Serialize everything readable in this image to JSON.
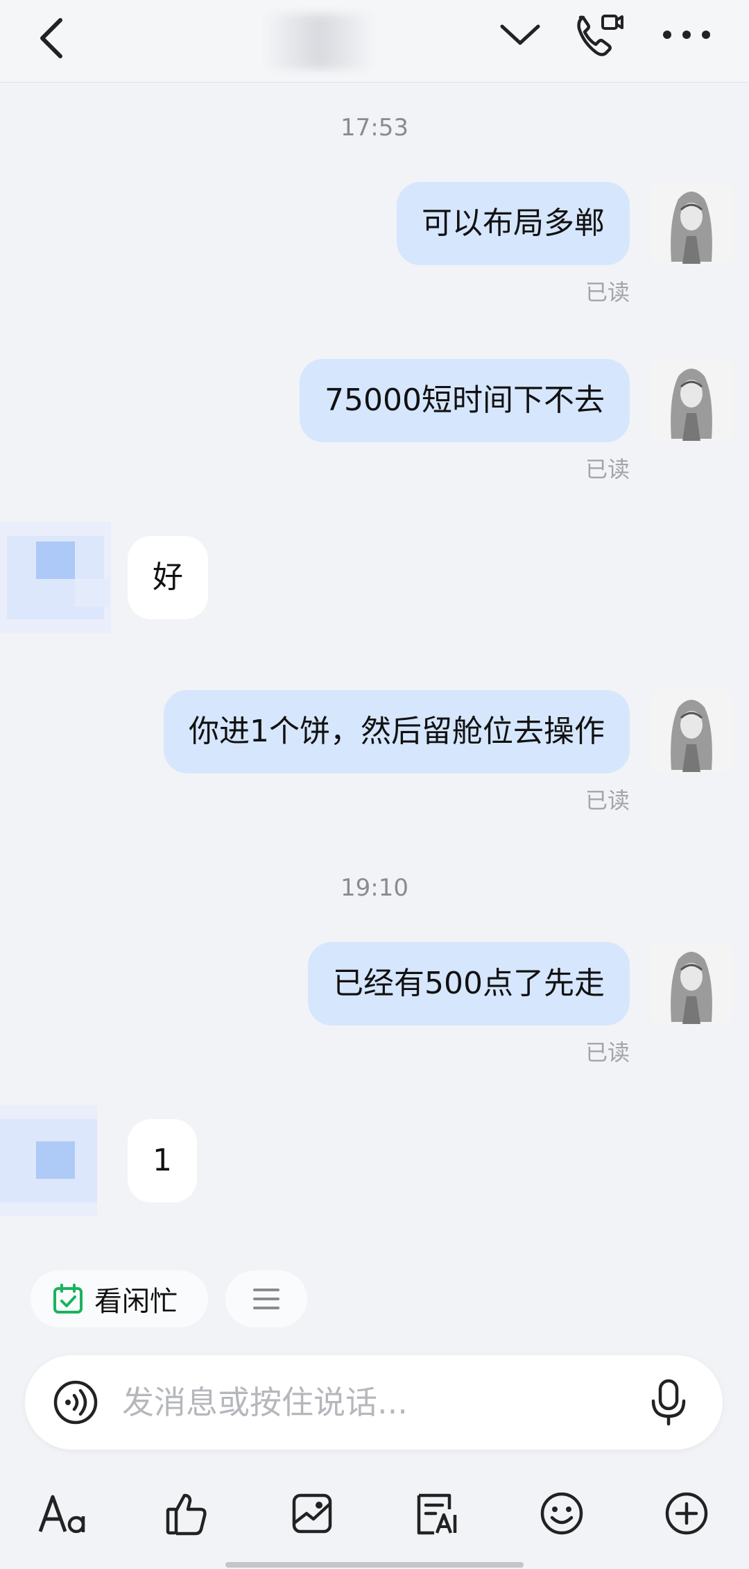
{
  "header": {
    "title": ""
  },
  "messages": [
    {
      "type": "time",
      "text": "17:53"
    },
    {
      "type": "me",
      "text": "可以布局多郸",
      "status": "已读"
    },
    {
      "type": "me",
      "text": "75000短时间下不去",
      "status": "已读"
    },
    {
      "type": "them",
      "text": "好"
    },
    {
      "type": "me",
      "text": "你进1个饼，然后留舱位去操作",
      "status": "已读"
    },
    {
      "type": "time",
      "text": "19:10"
    },
    {
      "type": "me",
      "text": "已经有500点了先走",
      "status": "已读"
    },
    {
      "type": "them",
      "text": "1"
    }
  ],
  "quick_actions": {
    "status_chip": "看闲忙"
  },
  "composer": {
    "placeholder": "发消息或按住说话..."
  },
  "icons": {
    "back": "chevron-left-icon",
    "dropdown": "chevron-down-icon",
    "call": "video-call-icon",
    "more": "more-icon",
    "voice": "voice-icon",
    "mic": "mic-icon",
    "font": "font-icon",
    "like": "thumbs-up-icon",
    "image": "image-icon",
    "ai": "ai-write-icon",
    "emoji": "emoji-icon",
    "plus": "plus-icon"
  }
}
